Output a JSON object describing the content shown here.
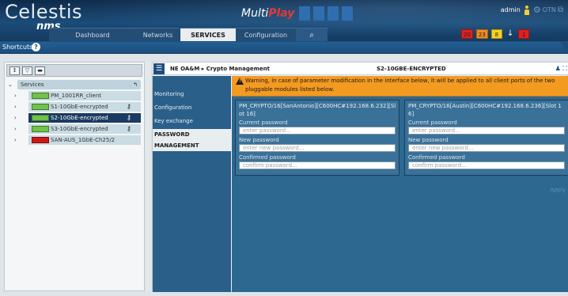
{
  "header": {
    "logo_main": "Celestis",
    "logo_sub": "nms",
    "brand_left": "Multi",
    "brand_right": "Play",
    "tabs": [
      {
        "label": "Dashboard"
      },
      {
        "label": "Networks"
      },
      {
        "label": "SERVICES",
        "active": true
      },
      {
        "label": "Configuration"
      }
    ],
    "search_icon": "search-icon",
    "user": "admin",
    "otn_label": "OTN",
    "alarms": [
      {
        "value": "20",
        "color": "#e02020"
      },
      {
        "value": "23",
        "color": "#f08c1e"
      },
      {
        "value": "8",
        "color": "#f6d21c"
      },
      {
        "value": "↓",
        "color": "#ffffff"
      },
      {
        "value": "1",
        "color": "#e02020"
      }
    ]
  },
  "shortcuts": {
    "label": "Shortcuts",
    "help_icon": "?"
  },
  "left_panel": {
    "toolbar_icons": [
      "sort-icon",
      "filter-icon",
      "view-icon"
    ],
    "tree_root": {
      "label": "Services"
    },
    "items": [
      {
        "label": "PM_1001RR_client",
        "status": "ok",
        "key": false,
        "selected": false
      },
      {
        "label": "S1-10GbE-encrypted",
        "status": "ok",
        "key": true,
        "selected": false
      },
      {
        "label": "S2-10GbE-encrypted",
        "status": "ok",
        "key": true,
        "selected": true
      },
      {
        "label": "S3-10GbE-encrypted",
        "status": "ok",
        "key": true,
        "selected": false
      },
      {
        "label": "SAN-AUS_1GbE-Ch25/2",
        "status": "critical",
        "key": false,
        "selected": false
      }
    ]
  },
  "right_panel": {
    "breadcrumb": "NE OA&M ▸ Crypto Management",
    "title": "S2-10GBE-ENCRYPTED",
    "nav": [
      {
        "label": "Monitoring"
      },
      {
        "label": "Configuration"
      },
      {
        "label": "Key exchange"
      },
      {
        "label": "PASSWORD MANAGEMENT",
        "active": true
      }
    ],
    "warning": "Warning, in case of parameter modification in the interface below, it will be applied to all client ports of the two pluggable modules listed below.",
    "cards": [
      {
        "title": "PM_CRYPTO/16[SanAntonio][C600HC#192.168.6.232][Slot 16]",
        "current_label": "Current password",
        "current_placeholder": "enter password...",
        "new_label": "New password",
        "new_placeholder": "enter new password...",
        "confirm_label": "Confirmed password",
        "confirm_placeholder": "confirm password..."
      },
      {
        "title": "PM_CRYPTO/16[Austin][C600HC#192.168.6.236][Slot 16]",
        "current_label": "Current password",
        "current_placeholder": "enter password...",
        "new_label": "New password",
        "new_placeholder": "enter new password...",
        "confirm_label": "Confirmed password",
        "confirm_placeholder": "confirm password..."
      }
    ],
    "apply_label": "Apply"
  }
}
